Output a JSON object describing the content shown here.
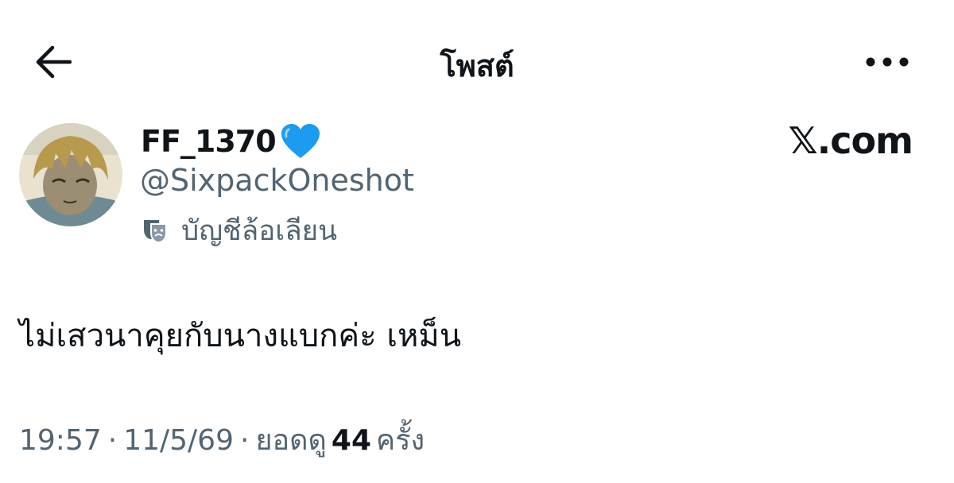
{
  "header": {
    "title": "โพสต์",
    "back_icon": "back-arrow-icon",
    "more_icon": "more-horizontal-icon"
  },
  "author": {
    "display_name": "FF_1370",
    "badge_icon": "blue-heart-icon",
    "handle": "@SixpackOneshot",
    "account_label": "บัญชีล้อเลียน",
    "account_label_icon": "theater-mask-icon"
  },
  "watermark": "𝕏.com",
  "post": {
    "text": "ไม่เสวนาคุยกับนางแบกค่ะ เหม็น"
  },
  "meta": {
    "time": "19:57",
    "separator": "·",
    "date": "11/5/69",
    "views_prefix": "ยอดดู",
    "views_count": "44",
    "views_suffix": "ครั้ง"
  },
  "colors": {
    "text_primary": "#0f1419",
    "text_secondary": "#536471",
    "heart_blue": "#1d9bf0"
  }
}
